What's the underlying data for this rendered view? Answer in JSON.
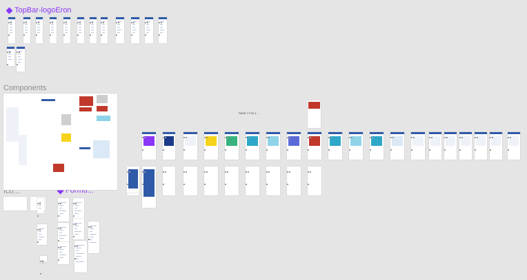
{
  "canvas": {
    "background": "#e5e5e5",
    "sections": {
      "topbar_component": "TopBar-logoEron",
      "components": "Components",
      "icons": "Ico...",
      "forms_component": "Formu...",
      "page_title": "PAGE 1 FOI 1 ..."
    }
  }
}
